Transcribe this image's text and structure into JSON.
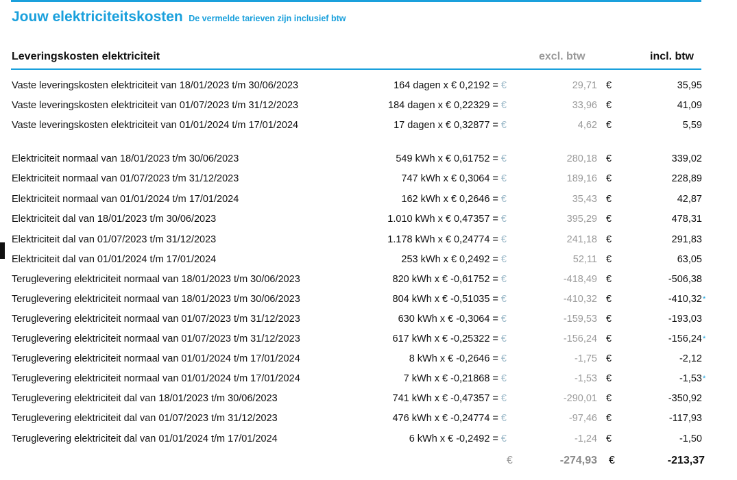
{
  "header": {
    "title": "Jouw elektriciteitskosten",
    "subtitle": "De vermelde tarieven zijn inclusief btw"
  },
  "table": {
    "section_label": "Leveringskosten elektriciteit",
    "col_excl": "excl. btw",
    "col_incl": "incl. btw",
    "currency": "€",
    "rows": [
      {
        "label": "Vaste leveringskosten elektriciteit van 18/01/2023 t/m 30/06/2023",
        "calc": "164 dagen x € 0,2192 = ",
        "excl": "29,71",
        "incl": "35,95",
        "star": ""
      },
      {
        "label": "Vaste leveringskosten elektriciteit van 01/07/2023 t/m 31/12/2023",
        "calc": "184 dagen x € 0,22329 = ",
        "excl": "33,96",
        "incl": "41,09",
        "star": ""
      },
      {
        "label": "Vaste leveringskosten elektriciteit van 01/01/2024 t/m 17/01/2024",
        "calc": "17 dagen x € 0,32877 = ",
        "excl": "4,62",
        "incl": "5,59",
        "star": ""
      },
      {
        "label": "Elektriciteit normaal van 18/01/2023 t/m 30/06/2023",
        "calc": "549 kWh x € 0,61752 = ",
        "excl": "280,18",
        "incl": "339,02",
        "star": ""
      },
      {
        "label": "Elektriciteit normaal van 01/07/2023 t/m 31/12/2023",
        "calc": "747 kWh x € 0,3064 = ",
        "excl": "189,16",
        "incl": "228,89",
        "star": ""
      },
      {
        "label": "Elektriciteit normaal van 01/01/2024 t/m 17/01/2024",
        "calc": "162 kWh x € 0,2646 = ",
        "excl": "35,43",
        "incl": "42,87",
        "star": ""
      },
      {
        "label": "Elektriciteit dal van 18/01/2023 t/m 30/06/2023",
        "calc": "1.010 kWh x € 0,47357 = ",
        "excl": "395,29",
        "incl": "478,31",
        "star": ""
      },
      {
        "label": "Elektriciteit dal van 01/07/2023 t/m 31/12/2023",
        "calc": "1.178 kWh x € 0,24774 = ",
        "excl": "241,18",
        "incl": "291,83",
        "star": ""
      },
      {
        "label": "Elektriciteit dal van 01/01/2024 t/m 17/01/2024",
        "calc": "253 kWh x € 0,2492 = ",
        "excl": "52,11",
        "incl": "63,05",
        "star": ""
      },
      {
        "label": "Teruglevering elektriciteit normaal van 18/01/2023 t/m 30/06/2023",
        "calc": "820 kWh x € -0,61752 = ",
        "excl": "-418,49",
        "incl": "-506,38",
        "star": ""
      },
      {
        "label": "Teruglevering elektriciteit normaal van 18/01/2023 t/m 30/06/2023",
        "calc": "804 kWh x € -0,51035 = ",
        "excl": "-410,32",
        "incl": "-410,32",
        "star": "*"
      },
      {
        "label": "Teruglevering elektriciteit normaal van 01/07/2023 t/m 31/12/2023",
        "calc": "630 kWh x € -0,3064 = ",
        "excl": "-159,53",
        "incl": "-193,03",
        "star": ""
      },
      {
        "label": "Teruglevering elektriciteit normaal van 01/07/2023 t/m 31/12/2023",
        "calc": "617 kWh x € -0,25322 = ",
        "excl": "-156,24",
        "incl": "-156,24",
        "star": "*"
      },
      {
        "label": "Teruglevering elektriciteit normaal van 01/01/2024 t/m 17/01/2024",
        "calc": "8 kWh x € -0,2646 = ",
        "excl": "-1,75",
        "incl": "-2,12",
        "star": ""
      },
      {
        "label": "Teruglevering elektriciteit normaal van 01/01/2024 t/m 17/01/2024",
        "calc": "7 kWh x € -0,21868 = ",
        "excl": "-1,53",
        "incl": "-1,53",
        "star": "*"
      },
      {
        "label": "Teruglevering elektriciteit dal van 18/01/2023 t/m 30/06/2023",
        "calc": "741 kWh x € -0,47357 = ",
        "excl": "-290,01",
        "incl": "-350,92",
        "star": ""
      },
      {
        "label": "Teruglevering elektriciteit dal van 01/07/2023 t/m 31/12/2023",
        "calc": "476 kWh x € -0,24774 = ",
        "excl": "-97,46",
        "incl": "-117,93",
        "star": ""
      },
      {
        "label": "Teruglevering elektriciteit dal van 01/01/2024 t/m 17/01/2024",
        "calc": "6 kWh x € -0,2492 = ",
        "excl": "-1,24",
        "incl": "-1,50",
        "star": ""
      }
    ],
    "total": {
      "excl": "-274,93",
      "incl": "-213,37"
    }
  }
}
